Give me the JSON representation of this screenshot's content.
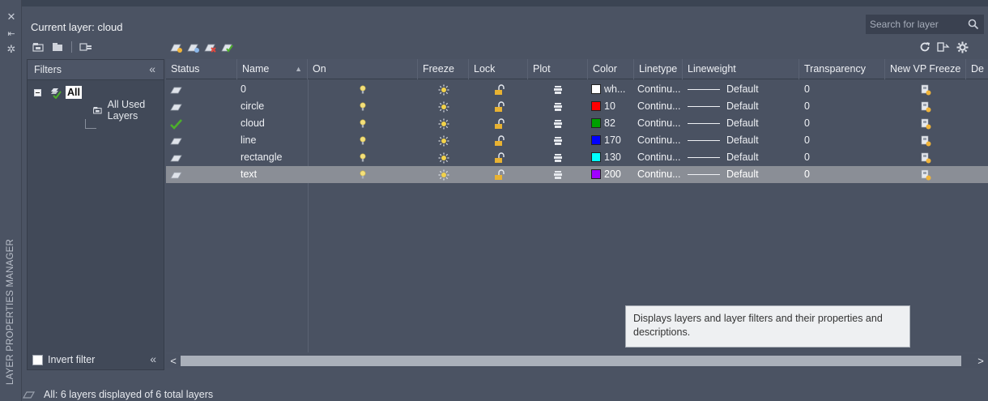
{
  "palette_title": "LAYER PROPERTIES MANAGER",
  "current_layer_label": "Current layer: cloud",
  "search": {
    "placeholder": "Search for layer"
  },
  "filters": {
    "header": "Filters",
    "collapse_glyph": "«",
    "tree": [
      {
        "label": "All",
        "selected": true
      },
      {
        "label": "All Used Layers"
      }
    ],
    "invert_filter_label": "Invert filter",
    "invert_filter_checked": false
  },
  "columns": [
    {
      "key": "status",
      "label": "Status"
    },
    {
      "key": "name",
      "label": "Name",
      "sorted": "asc"
    },
    {
      "key": "on",
      "label": "On"
    },
    {
      "key": "freeze",
      "label": "Freeze"
    },
    {
      "key": "lock",
      "label": "Lock"
    },
    {
      "key": "plot",
      "label": "Plot"
    },
    {
      "key": "color",
      "label": "Color"
    },
    {
      "key": "linetype",
      "label": "Linetype"
    },
    {
      "key": "lineweight",
      "label": "Lineweight"
    },
    {
      "key": "transparency",
      "label": "Transparency"
    },
    {
      "key": "new_vp_freeze",
      "label": "New VP Freeze"
    },
    {
      "key": "description",
      "label": "De"
    }
  ],
  "layers": [
    {
      "status": "layer",
      "name": "0",
      "on": "bulb-on-icon",
      "freeze": "sun-icon",
      "lock": "unlocked-icon",
      "plot": "printer-icon",
      "color_hex": "#ffffff",
      "color_label": "wh...",
      "linetype": "Continu...",
      "lineweight": "Default",
      "transparency": "0",
      "new_vp_freeze": "new-vp-freeze-icon",
      "current": false,
      "selected": false
    },
    {
      "status": "layer",
      "name": "circle",
      "on": "bulb-on-icon",
      "freeze": "sun-icon",
      "lock": "unlocked-icon",
      "plot": "printer-icon",
      "color_hex": "#ff0000",
      "color_label": "10",
      "linetype": "Continu...",
      "lineweight": "Default",
      "transparency": "0",
      "new_vp_freeze": "new-vp-freeze-icon",
      "current": false,
      "selected": false
    },
    {
      "status": "current",
      "name": "cloud",
      "on": "bulb-on-icon",
      "freeze": "sun-icon",
      "lock": "unlocked-icon",
      "plot": "printer-icon",
      "color_hex": "#00a000",
      "color_label": "82",
      "linetype": "Continu...",
      "lineweight": "Default",
      "transparency": "0",
      "new_vp_freeze": "new-vp-freeze-icon",
      "current": true,
      "selected": false
    },
    {
      "status": "layer",
      "name": "line",
      "on": "bulb-on-icon",
      "freeze": "sun-icon",
      "lock": "unlocked-icon",
      "plot": "printer-icon",
      "color_hex": "#0000ff",
      "color_label": "170",
      "linetype": "Continu...",
      "lineweight": "Default",
      "transparency": "0",
      "new_vp_freeze": "new-vp-freeze-icon",
      "current": false,
      "selected": false
    },
    {
      "status": "layer",
      "name": "rectangle",
      "on": "bulb-on-icon",
      "freeze": "sun-icon",
      "lock": "unlocked-icon",
      "plot": "printer-icon",
      "color_hex": "#00ffff",
      "color_label": "130",
      "linetype": "Continu...",
      "lineweight": "Default",
      "transparency": "0",
      "new_vp_freeze": "new-vp-freeze-icon",
      "current": false,
      "selected": false
    },
    {
      "status": "layer",
      "name": "text",
      "on": "bulb-on-icon",
      "freeze": "sun-icon",
      "lock": "unlocked-icon",
      "plot": "printer-icon",
      "color_hex": "#a000ff",
      "color_label": "200",
      "linetype": "Continu...",
      "lineweight": "Default",
      "transparency": "0",
      "new_vp_freeze": "new-vp-freeze-icon",
      "current": false,
      "selected": true
    }
  ],
  "tooltip": "Displays layers and layer filters and their properties and descriptions.",
  "status_text": "All: 6 layers displayed of 6 total layers",
  "scroll": {
    "left": "<",
    "right": ">"
  },
  "accent_colors": {
    "current_check": "#4caf2b",
    "bulb": "#f4e07a",
    "sun": "#f2d24a",
    "lock": "#e8b232"
  }
}
